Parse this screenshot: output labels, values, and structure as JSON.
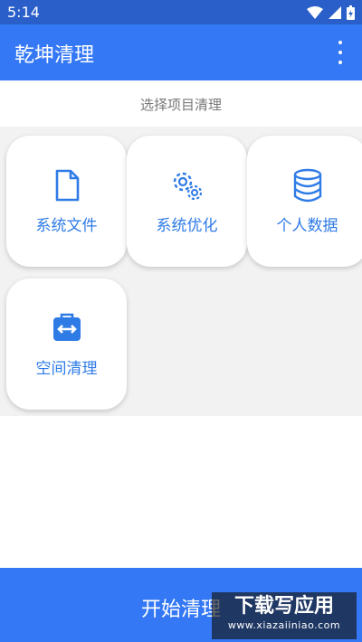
{
  "status_bar": {
    "time": "5:14"
  },
  "app_bar": {
    "title": "乾坤清理"
  },
  "subtitle": "选择项目清理",
  "tiles": [
    {
      "label": "系统文件",
      "icon": "file-icon"
    },
    {
      "label": "系统优化",
      "icon": "gear-icon"
    },
    {
      "label": "个人数据",
      "icon": "database-icon"
    },
    {
      "label": "空间清理",
      "icon": "storage-icon"
    }
  ],
  "bottom_bar": {
    "label": "开始清理"
  },
  "watermark": {
    "main": "下载写应用",
    "url": "www.xiazaiiniao.com"
  },
  "colors": {
    "status_bar": "#2a5fc9",
    "app_bar": "#3478f6",
    "accent": "#2e7be6",
    "background": "#f2f2f2"
  }
}
